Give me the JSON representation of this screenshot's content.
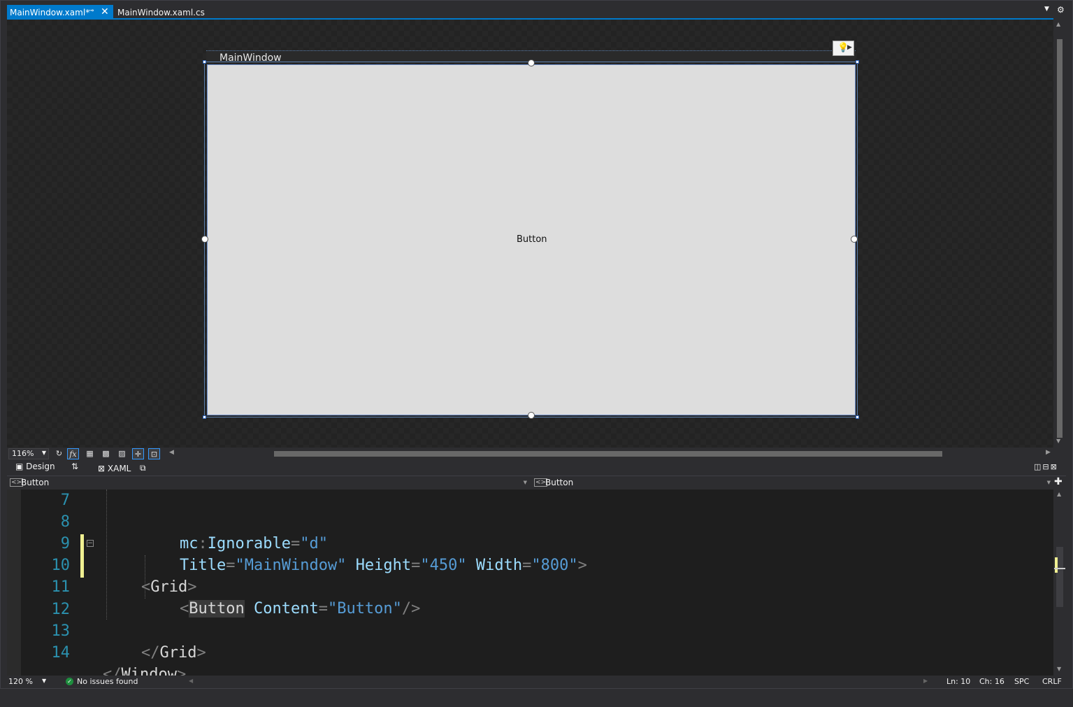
{
  "tabs": [
    {
      "label": "MainWindow.xaml*",
      "active": true
    },
    {
      "label": "MainWindow.xaml.cs",
      "active": false
    }
  ],
  "designer": {
    "window_title": "MainWindow",
    "button_content": "Button",
    "zoom": "116%"
  },
  "view_switch": {
    "design_label": "Design",
    "xaml_label": "XAML"
  },
  "navbar": {
    "left_element": "Button",
    "right_element": "Button"
  },
  "code_lines": [
    {
      "num": "7"
    },
    {
      "num": "8"
    },
    {
      "num": "9"
    },
    {
      "num": "10"
    },
    {
      "num": "11"
    },
    {
      "num": "12"
    },
    {
      "num": "13"
    },
    {
      "num": "14"
    }
  ],
  "code_tokens": {
    "l7_prefix": "mc",
    "l7_colon": ":",
    "l7_attr": "Ignorable",
    "l7_eq": "=",
    "l7_val": "\"d\"",
    "l8_attr1": "Title",
    "l8_eq1": "=",
    "l8_val1": "\"MainWindow\"",
    "l8_attr2": "Height",
    "l8_eq2": "=",
    "l8_val2": "\"450\"",
    "l8_attr3": "Width",
    "l8_eq3": "=",
    "l8_val3": "\"800\"",
    "l8_close": ">",
    "l9_open": "<",
    "l9_tag": "Grid",
    "l9_close": ">",
    "l10_open": "<",
    "l10_tag": "Button",
    "l10_attr": "Content",
    "l10_eq": "=",
    "l10_val": "\"Button\"",
    "l10_close": "/>",
    "l12_open": "</",
    "l12_tag": "Grid",
    "l12_close": ">",
    "l13_open": "</",
    "l13_tag": "Window",
    "l13_close": ">"
  },
  "statusbar": {
    "zoom": "120 %",
    "issues": "No issues found",
    "ln": "Ln: 10",
    "ch": "Ch: 16",
    "spc": "SPC",
    "crlf": "CRLF"
  },
  "colors": {
    "accent": "#007acc",
    "editor_bg": "#1e1e1e",
    "line_number": "#2b91af",
    "attribute": "#9cdcfe",
    "keyword_value": "#569cd6",
    "changed_line_marker": "#efef91"
  },
  "icons": {
    "pin": "pin-icon",
    "close": "close-icon",
    "lightbulb": "lightbulb-icon",
    "refresh": "refresh-icon",
    "effects": "fx-icon",
    "grid": "grid-icon",
    "snap": "snap-icon",
    "checkmark": "check-circle-icon"
  }
}
